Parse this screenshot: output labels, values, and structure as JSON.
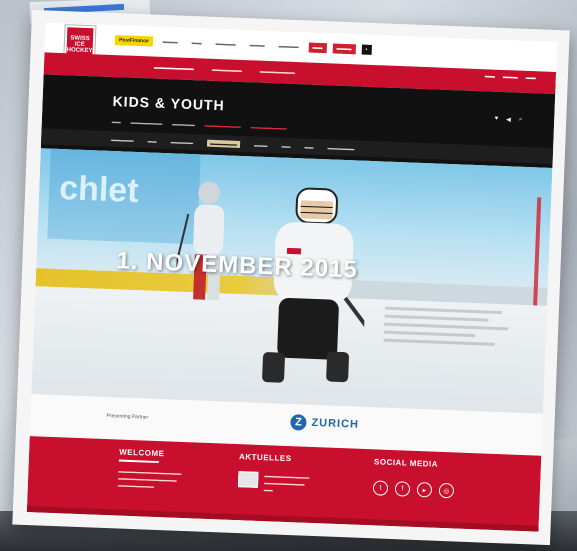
{
  "header": {
    "logo_text": "SWISS ICE HOCKEY",
    "sponsors": [
      "PostFinance",
      "",
      "",
      "",
      "",
      "",
      "",
      "",
      ""
    ]
  },
  "main_nav": {
    "items": [
      "",
      "",
      ""
    ]
  },
  "utility_nav": {
    "items": [
      "",
      "",
      ""
    ]
  },
  "section": {
    "title": "KIDS & YOUTH",
    "subnav": [
      "",
      "",
      "",
      "",
      ""
    ],
    "subnav2": [
      "",
      "",
      "",
      "",
      "",
      ""
    ]
  },
  "hero": {
    "date_headline": "1. NOVEMBER 2015",
    "sign_text": "chlet"
  },
  "presenting": {
    "label": "Presenting Partner",
    "partner_name": "ZURICH"
  },
  "footer": {
    "welcome_title": "WELCOME",
    "news_title": "AKTUELLES",
    "social_title": "SOCIAL MEDIA"
  },
  "colors": {
    "brand_red": "#c8102e",
    "dark": "#111111",
    "zurich_blue": "#2167ae"
  }
}
